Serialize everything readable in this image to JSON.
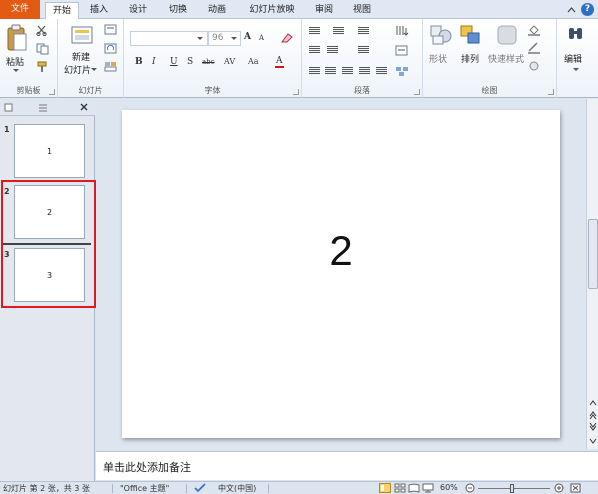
{
  "ribbon_tabs": [
    "文件",
    "开始",
    "插入",
    "设计",
    "切换",
    "动画",
    "幻灯片放映",
    "审阅",
    "视图"
  ],
  "clipboard": {
    "paste_label": "粘贴",
    "group_label": "剪贴板"
  },
  "slides_group": {
    "new_slide_label_1": "新建",
    "new_slide_label_2": "幻灯片",
    "group_label": "幻灯片"
  },
  "font_group": {
    "font_size": "96",
    "grow_label": "A",
    "shrink_label": "A",
    "bold": "B",
    "italic": "I",
    "underline": "U",
    "shadow": "S",
    "strike": "abc",
    "spacing": "AV",
    "case": "Aa",
    "color": "A",
    "group_label": "字体"
  },
  "paragraph_group": {
    "group_label": "段落"
  },
  "drawing_group": {
    "shapes_label": "形状",
    "arrange_label": "排列",
    "quick_styles_label": "快速样式",
    "group_label": "绘图"
  },
  "editing_group": {
    "label": "编辑"
  },
  "slides": [
    {
      "number": "1",
      "text": "1"
    },
    {
      "number": "2",
      "text": "2"
    },
    {
      "number": "3",
      "text": "3"
    }
  ],
  "current_slide_text": "2",
  "notes_placeholder": "单击此处添加备注",
  "status": {
    "slide_info": "幻灯片 第 2 张，共 3 张",
    "theme": "\"Office 主题\"",
    "language": "中文(中国)",
    "zoom": "60%"
  },
  "colors": {
    "file_tab": "#e35a12",
    "selection_red": "#e0191e",
    "help_blue": "#2f6fc4"
  }
}
